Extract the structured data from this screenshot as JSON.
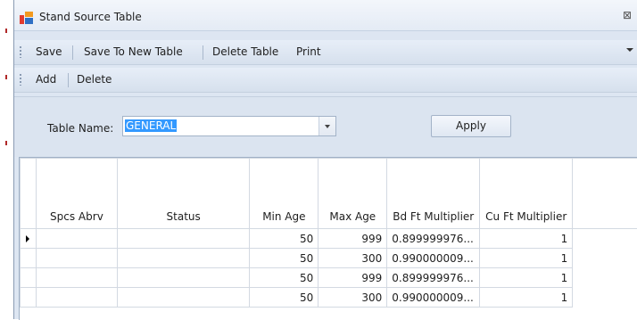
{
  "window": {
    "title": "Stand Source Table",
    "close_glyph": "⊠"
  },
  "toolbar": {
    "save": "Save",
    "save_new": "Save To New Table",
    "delete_table": "Delete Table",
    "print": "Print"
  },
  "row_toolbar": {
    "add": "Add",
    "delete": "Delete"
  },
  "form": {
    "table_name_label": "Table Name:",
    "table_name_value": "GENERAL",
    "apply_label": "Apply"
  },
  "grid": {
    "columns": [
      "Spcs Abrv",
      "Status",
      "Min Age",
      "Max Age",
      "Bd Ft Multiplier",
      "Cu Ft Multiplier"
    ],
    "rows": [
      {
        "spcs": "",
        "status": "",
        "min_age": "50",
        "max_age": "999",
        "bd_ft": "0.899999976...",
        "cu_ft": "1",
        "current": true
      },
      {
        "spcs": "",
        "status": "",
        "min_age": "50",
        "max_age": "300",
        "bd_ft": "0.990000009...",
        "cu_ft": "1"
      },
      {
        "spcs": "",
        "status": "",
        "min_age": "50",
        "max_age": "999",
        "bd_ft": "0.899999976...",
        "cu_ft": "1"
      },
      {
        "spcs": "",
        "status": "",
        "min_age": "50",
        "max_age": "300",
        "bd_ft": "0.990000009...",
        "cu_ft": "1"
      }
    ]
  },
  "icons": {
    "app": "table-app-icon",
    "close": "close-icon",
    "dropdown": "chevron-down-icon",
    "current_row": "row-pointer-icon"
  },
  "colors": {
    "selection": "#3399ff",
    "frame": "#dde6f2",
    "toolbar": "#d6e0ed"
  }
}
